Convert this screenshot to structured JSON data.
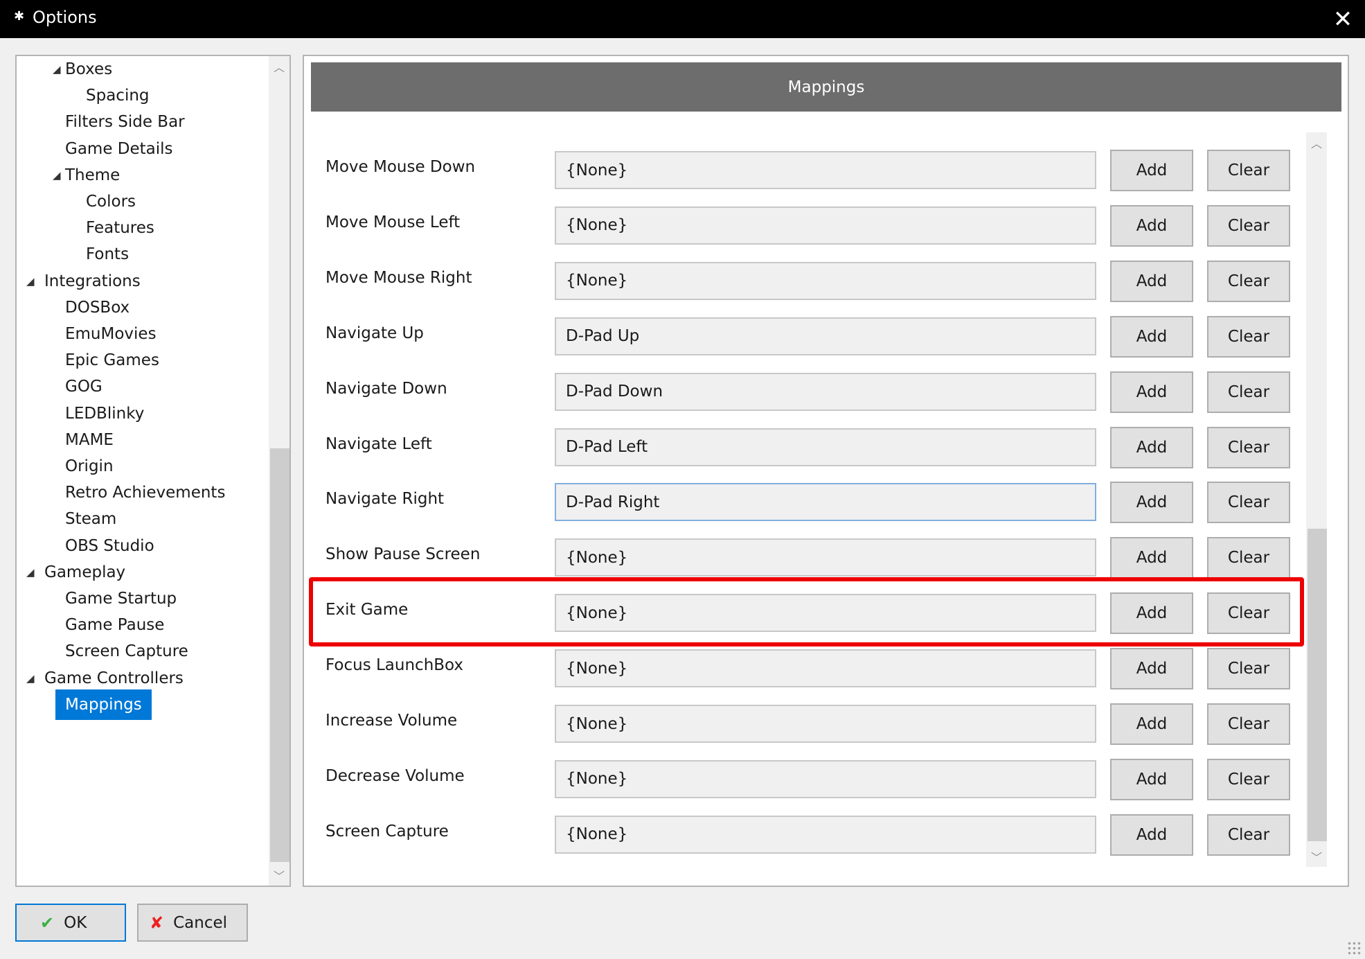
{
  "window": {
    "title": "Options",
    "icon": "gear-icon",
    "close": "✕"
  },
  "tree": {
    "items": [
      {
        "label": "Boxes",
        "level": 1,
        "expanded": true
      },
      {
        "label": "Spacing",
        "level": 2
      },
      {
        "label": "Filters Side Bar",
        "level": 1
      },
      {
        "label": "Game Details",
        "level": 1
      },
      {
        "label": "Theme",
        "level": 1,
        "expanded": true
      },
      {
        "label": "Colors",
        "level": 2
      },
      {
        "label": "Features",
        "level": 2
      },
      {
        "label": "Fonts",
        "level": 2
      },
      {
        "label": "Integrations",
        "level": 0,
        "expanded": true
      },
      {
        "label": "DOSBox",
        "level": 1
      },
      {
        "label": "EmuMovies",
        "level": 1
      },
      {
        "label": "Epic Games",
        "level": 1
      },
      {
        "label": "GOG",
        "level": 1
      },
      {
        "label": "LEDBlinky",
        "level": 1
      },
      {
        "label": "MAME",
        "level": 1
      },
      {
        "label": "Origin",
        "level": 1
      },
      {
        "label": "Retro Achievements",
        "level": 1
      },
      {
        "label": "Steam",
        "level": 1
      },
      {
        "label": "OBS Studio",
        "level": 1
      },
      {
        "label": "Gameplay",
        "level": 0,
        "expanded": true
      },
      {
        "label": "Game Startup",
        "level": 1
      },
      {
        "label": "Game Pause",
        "level": 1
      },
      {
        "label": "Screen Capture",
        "level": 1
      },
      {
        "label": "Game Controllers",
        "level": 0,
        "expanded": true
      },
      {
        "label": "Mappings",
        "level": 1,
        "selected": true
      }
    ]
  },
  "main": {
    "header": "Mappings",
    "add_label": "Add",
    "clear_label": "Clear",
    "rows": [
      {
        "label": "Move Mouse Down",
        "value": "{None}"
      },
      {
        "label": "Move Mouse Left",
        "value": "{None}"
      },
      {
        "label": "Move Mouse Right",
        "value": "{None}"
      },
      {
        "label": "Navigate Up",
        "value": "D-Pad Up"
      },
      {
        "label": "Navigate Down",
        "value": "D-Pad Down"
      },
      {
        "label": "Navigate Left",
        "value": "D-Pad Left"
      },
      {
        "label": "Navigate Right",
        "value": "D-Pad Right",
        "focused": true
      },
      {
        "label": "Show Pause Screen",
        "value": "{None}"
      },
      {
        "label": "Exit Game",
        "value": "{None}",
        "highlighted": true
      },
      {
        "label": "Focus LaunchBox",
        "value": "{None}"
      },
      {
        "label": "Increase Volume",
        "value": "{None}"
      },
      {
        "label": "Decrease Volume",
        "value": "{None}"
      },
      {
        "label": "Screen Capture",
        "value": "{None}"
      }
    ]
  },
  "footer": {
    "ok_label": "OK",
    "cancel_label": "Cancel"
  },
  "colors": {
    "selection": "#0078d7",
    "highlight": "#ee0000",
    "header_bg": "#6d6d6d"
  }
}
